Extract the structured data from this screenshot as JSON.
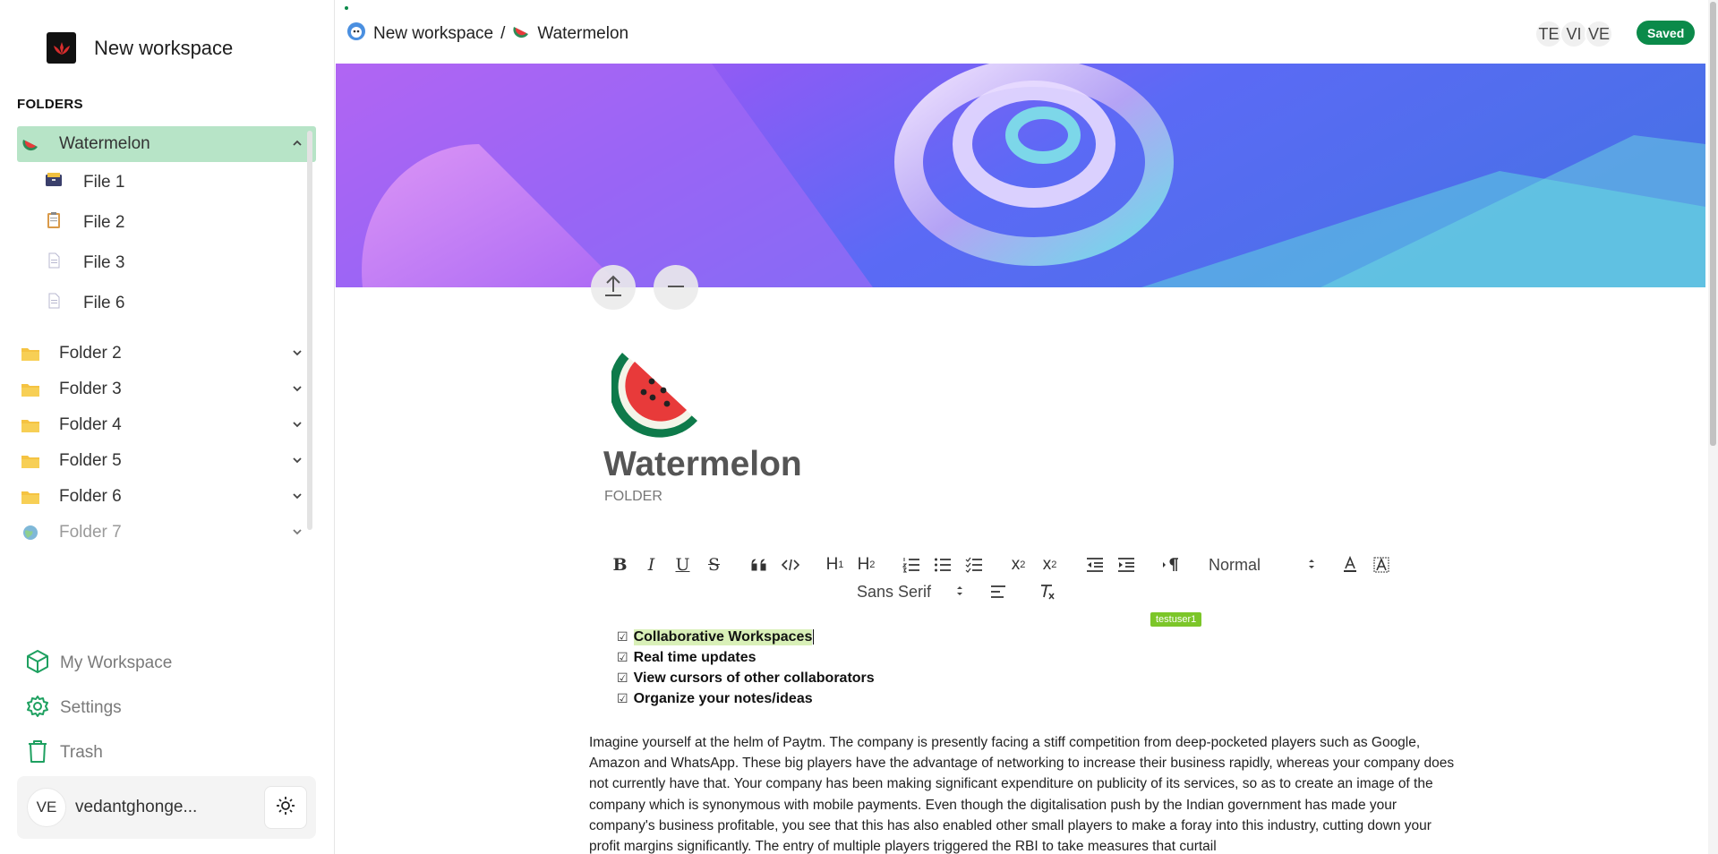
{
  "workspace": {
    "name": "New workspace"
  },
  "sidebar": {
    "folders_label": "FOLDERS",
    "active_folder": {
      "label": "Watermelon",
      "files": [
        {
          "label": "File 1",
          "icon": "card-index-icon"
        },
        {
          "label": "File 2",
          "icon": "clipboard-icon"
        },
        {
          "label": "File 3",
          "icon": "page-icon"
        },
        {
          "label": "File 6",
          "icon": "page-icon"
        }
      ]
    },
    "folders": [
      {
        "label": "Folder 2"
      },
      {
        "label": "Folder 3"
      },
      {
        "label": "Folder 4"
      },
      {
        "label": "Folder 5"
      },
      {
        "label": "Folder 6"
      },
      {
        "label": "Folder 7"
      }
    ],
    "nav": {
      "my_workspace": "My Workspace",
      "settings": "Settings",
      "trash": "Trash"
    },
    "user": {
      "initials": "VE",
      "name": "vedantghonge..."
    }
  },
  "header": {
    "breadcrumb_workspace": "New workspace",
    "breadcrumb_sep": "/",
    "breadcrumb_folder": "Watermelon",
    "collaborators": [
      "TE",
      "VI",
      "VE"
    ],
    "status": "Saved"
  },
  "document": {
    "title": "Watermelon",
    "type": "FOLDER",
    "toolbar": {
      "header_select": "Normal",
      "font_select": "Sans Serif"
    },
    "cursor_label": "testuser1",
    "checklist": [
      "Collaborative Workspaces",
      "Real time updates",
      "View cursors of other collaborators",
      "Organize your notes/ideas"
    ],
    "paragraph": "Imagine yourself at the helm of Paytm. The company is presently facing a stiff competition from deep-pocketed players such as Google, Amazon and WhatsApp. These big players have the advantage of networking to increase their business rapidly, whereas your company does not currently have that. Your company has been making significant expenditure on publicity of its services, so as to create an image of the company which is synonymous with mobile payments. Even though the digitalisation push by the Indian government has made your company's business profitable, you see that this has also enabled other small players to make a foray into this industry, cutting down your profit margins significantly. The entry of multiple players triggered the RBI to take measures that curtail"
  },
  "colors": {
    "accent": "#0b8a4a",
    "active_bg": "#b7e4c7"
  }
}
